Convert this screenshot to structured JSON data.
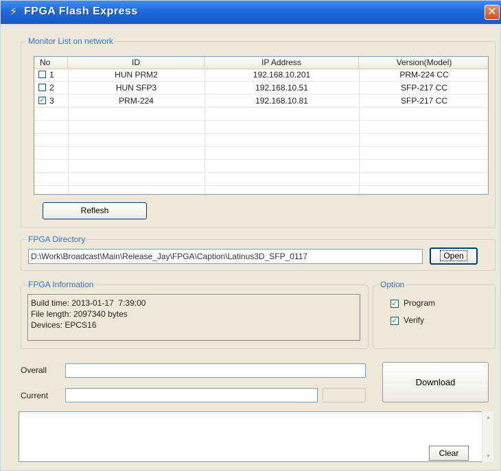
{
  "window": {
    "title": "FPGA Flash Express",
    "close_glyph": "✕",
    "icon": "lightning-icon"
  },
  "monitor_list": {
    "legend": "Monitor List on network",
    "columns": [
      "No",
      "ID",
      "IP Address",
      "Version(Model)"
    ],
    "rows": [
      {
        "checked": false,
        "no": "1",
        "id": "HUN PRM2",
        "ip": "192.168.10.201",
        "version": "PRM-224 CC"
      },
      {
        "checked": false,
        "no": "2",
        "id": "HUN SFP3",
        "ip": "192.168.10.51",
        "version": "SFP-217 CC"
      },
      {
        "checked": true,
        "no": "3",
        "id": "PRM-224",
        "ip": "192.168.10.81",
        "version": "SFP-217 CC"
      }
    ],
    "refresh_label": "Reflesh"
  },
  "directory": {
    "legend": "FPGA Directory",
    "path": "D:\\Work\\Broadcast\\Main\\Release_Jay\\FPGA\\Caption\\Latinus3D_SFP_0117",
    "open_label": "Open"
  },
  "information": {
    "legend": "FPGA Information",
    "build_time": "Build time: 2013-01-17  7:39:00",
    "file_length": "File length: 2097340 bytes",
    "devices": "Devices: EPCS16"
  },
  "option": {
    "legend": "Option",
    "program": {
      "label": "Program",
      "checked": true
    },
    "verify": {
      "label": "Verify",
      "checked": true
    }
  },
  "progress": {
    "overall_label": "Overall",
    "current_label": "Current"
  },
  "download_label": "Download",
  "clear_label": "Clear",
  "colors": {
    "title_bar": "#1f6ad8",
    "legend_text": "#3a6ec4",
    "window_bg": "#ece9d8",
    "check_mark": "#21a121"
  }
}
